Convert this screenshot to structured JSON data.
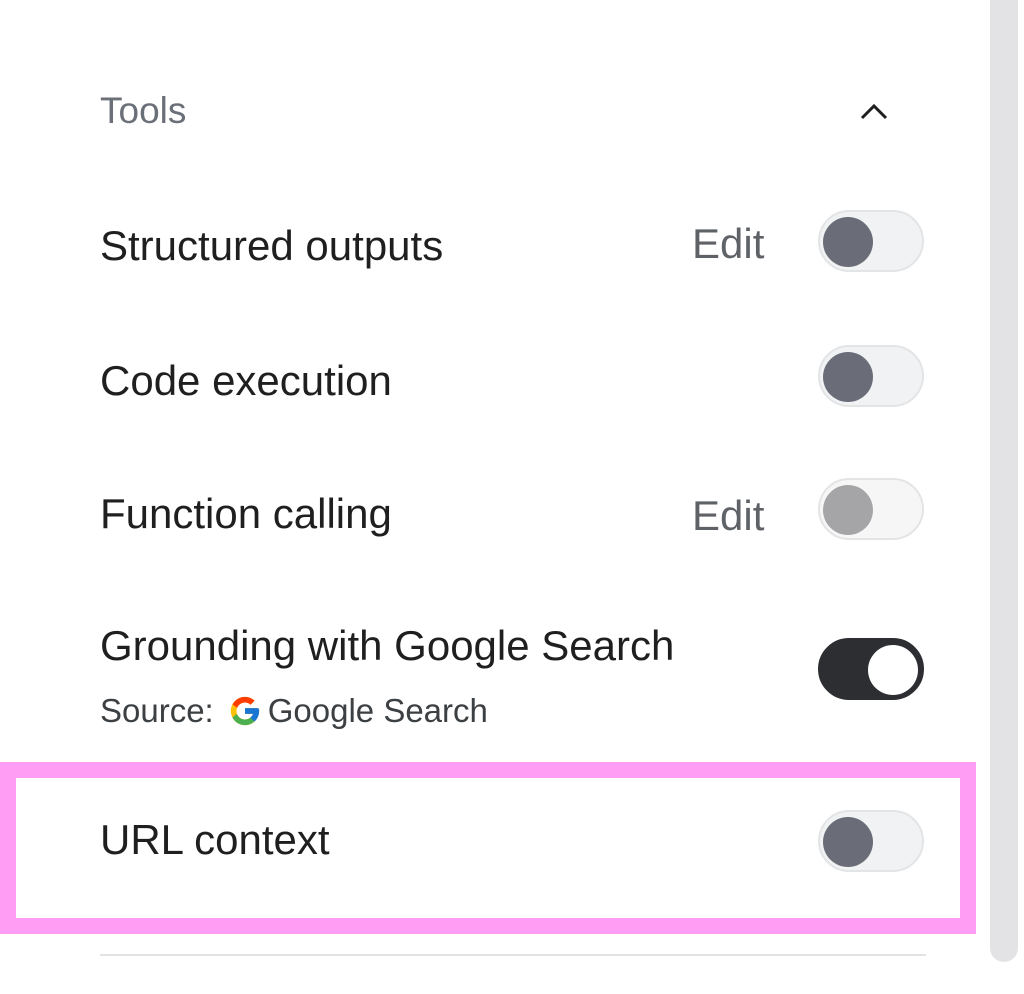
{
  "tools": {
    "title": "Tools",
    "collapse_icon": "chevron-up-icon",
    "items": [
      {
        "label": "Structured outputs",
        "edit_label": "Edit",
        "enabled": false
      },
      {
        "label": "Code execution",
        "enabled": false
      },
      {
        "label": "Function calling",
        "edit_label": "Edit",
        "enabled": false,
        "disabled": true
      },
      {
        "label": "Grounding with Google Search",
        "enabled": true,
        "source_label": "Source:",
        "source_name": "Google Search",
        "source_icon": "google-g-icon"
      },
      {
        "label": "URL context",
        "enabled": false
      }
    ]
  },
  "colors": {
    "highlight": "#ff9df4",
    "toggle_on": "#2d2e32",
    "toggle_knob_off": "#6a6c78"
  }
}
